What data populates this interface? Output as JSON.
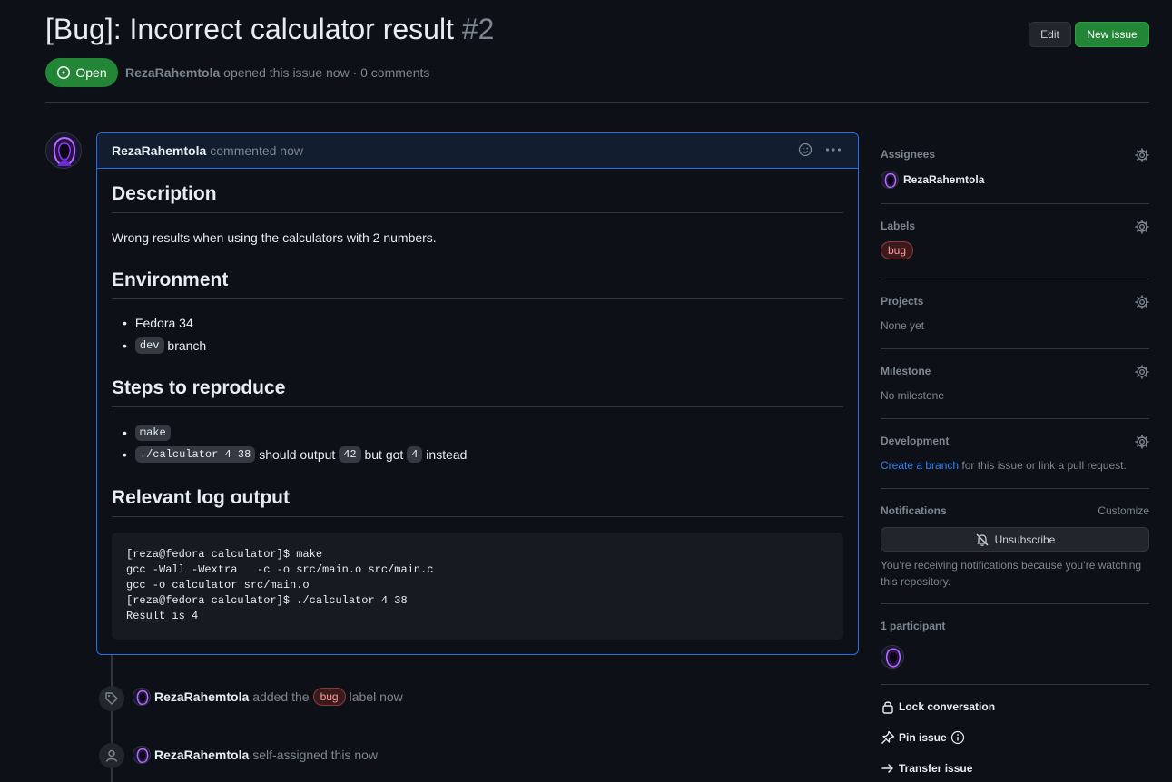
{
  "issue": {
    "title": "[Bug]: Incorrect calculator result",
    "number": "#2",
    "state": "Open",
    "author": "RezaRahemtola",
    "opened_text": "opened this issue now · 0 comments"
  },
  "header_buttons": {
    "edit": "Edit",
    "new_issue": "New issue"
  },
  "comment": {
    "author": "RezaRahemtola",
    "time_text": "commented now",
    "sections": {
      "description": "Description",
      "description_text": "Wrong results when using the calculators with 2 numbers.",
      "environment": "Environment",
      "env_os": "Fedora 34",
      "env_branch_code": "dev",
      "env_branch_text": "branch",
      "steps": "Steps to reproduce",
      "step1_code": "make",
      "step2_code": "./calculator 4 38",
      "step2_text1": "should output",
      "step2_code2": "42",
      "step2_text2": "but got",
      "step2_code3": "4",
      "step2_text3": "instead",
      "log": "Relevant log output",
      "log_output": "[reza@fedora calculator]$ make\ngcc -Wall -Wextra   -c -o src/main.o src/main.c\ngcc -o calculator src/main.o\n[reza@fedora calculator]$ ./calculator 4 38\nResult is 4"
    }
  },
  "timeline": [
    {
      "author": "RezaRahemtola",
      "pre": "added the",
      "label": "bug",
      "post": "label now",
      "icon": "tag-icon"
    },
    {
      "author": "RezaRahemtola",
      "pre": "self-assigned this now",
      "icon": "person-icon"
    }
  ],
  "sidebar": {
    "assignees": {
      "title": "Assignees",
      "name": "RezaRahemtola"
    },
    "labels": {
      "title": "Labels",
      "label": "bug"
    },
    "projects": {
      "title": "Projects",
      "value": "None yet"
    },
    "milestone": {
      "title": "Milestone",
      "value": "No milestone"
    },
    "development": {
      "title": "Development",
      "link": "Create a branch",
      "text": "for this issue or link a pull request."
    },
    "notifications": {
      "title": "Notifications",
      "customize": "Customize",
      "button": "Unsubscribe",
      "reason": "You’re receiving notifications because you’re watching this repository."
    },
    "participants": {
      "title": "1 participant"
    },
    "actions": {
      "lock": "Lock conversation",
      "pin": "Pin issue",
      "transfer": "Transfer issue"
    }
  },
  "colors": {
    "accent": "#2f81f7",
    "open_green": "#238636",
    "bug_label": "#ff9b99",
    "background": "#0d1117"
  }
}
